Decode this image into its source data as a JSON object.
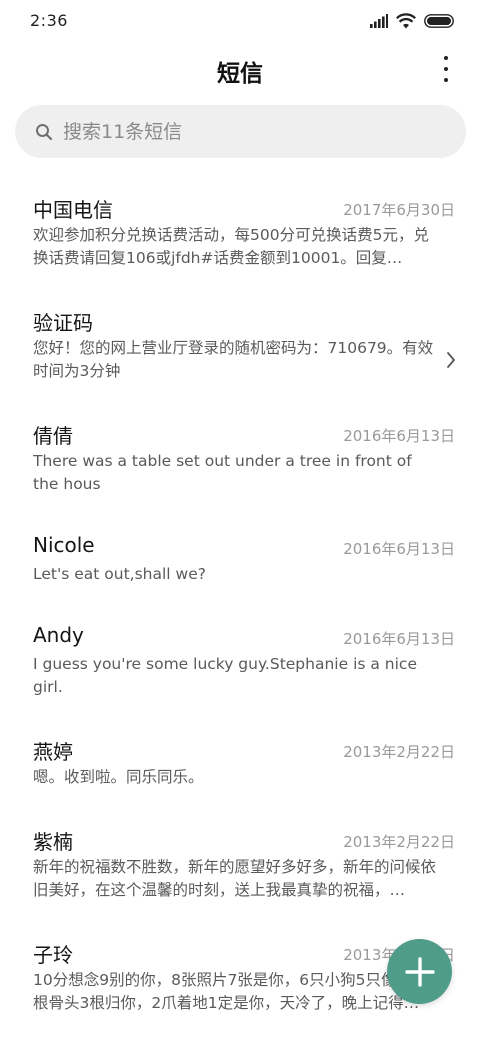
{
  "status_bar": {
    "time": "2:36",
    "icons": [
      "signal-icon",
      "wifi-icon",
      "battery-icon"
    ]
  },
  "header": {
    "title": "短信",
    "more_icon": "more-vertical-icon"
  },
  "search": {
    "placeholder": "搜索11条短信",
    "icon": "search-icon"
  },
  "messages": [
    {
      "name": "中国电信",
      "date": "2017年6月30日",
      "preview": "欢迎参加积分兑换话费活动，每500分可兑换话费5元，兑换话费请回复106或jfdh#话费金额到10001。回复…"
    },
    {
      "name": "验证码",
      "date": "",
      "preview": "您好！您的网上营业厅登录的随机密码为：710679。有效时间为3分钟"
    },
    {
      "name": "倩倩",
      "date": "2016年6月13日",
      "preview": "There was a table set out under a tree in front of the hous"
    },
    {
      "name": "Nicole",
      "date": "2016年6月13日",
      "preview": "Let's eat out,shall we?"
    },
    {
      "name": "Andy",
      "date": "2016年6月13日",
      "preview": "I guess you're some lucky guy.Stephanie is a nice girl."
    },
    {
      "name": "燕婷",
      "date": "2013年2月22日",
      "preview": "嗯。收到啦。同乐同乐。"
    },
    {
      "name": "紫楠",
      "date": "2013年2月22日",
      "preview": "新年的祝福数不胜数，新年的愿望好多好多，新年的问候依旧美好，在这个温馨的时刻，送上我最真挚的祝福，…"
    },
    {
      "name": "子玲",
      "date": "2013年2月22日",
      "preview": "10分想念9别的你，8张照片7张是你，6只小狗5只像你，4根骨头3根归你，2爪着地1定是你，天冷了，晚上记得…"
    }
  ],
  "fab": {
    "icon": "plus-icon",
    "color": "#4f9c8a"
  },
  "colors": {
    "accent": "#4f9c8a",
    "search_bg": "#efefef"
  }
}
